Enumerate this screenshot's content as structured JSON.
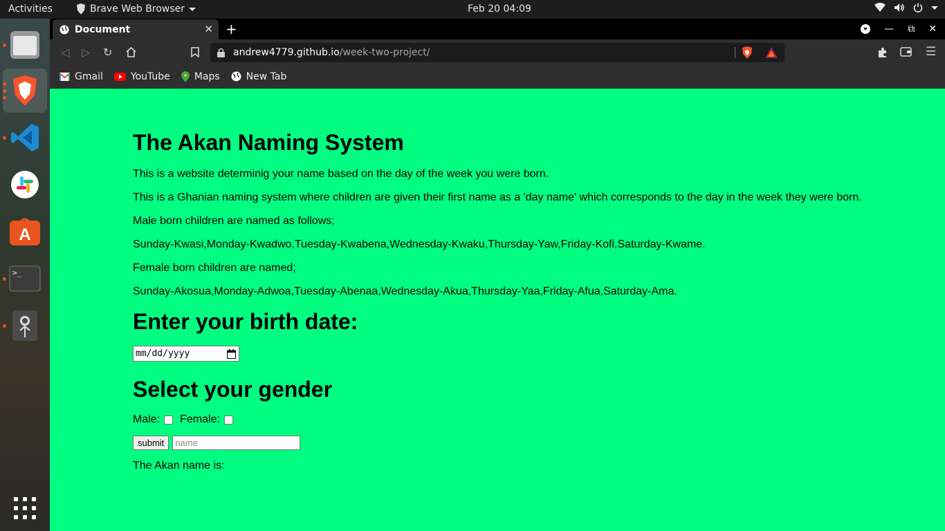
{
  "system": {
    "activities": "Activities",
    "app_menu": "Brave Web Browser",
    "clock": "Feb 20  04:09"
  },
  "dock": {
    "apps": [
      "Files",
      "Brave",
      "Visual Studio Code",
      "Slack",
      "Ubuntu Software",
      "Terminal",
      "Screenshot"
    ]
  },
  "browser": {
    "tab_title": "Document",
    "url_host": "andrew4779.github.io",
    "url_path": "/week-two-project/",
    "bookmarks": [
      "Gmail",
      "YouTube",
      "Maps",
      "New Tab"
    ]
  },
  "page": {
    "title": "The Akan Naming System",
    "paragraphs": [
      "This is a website determinig your name based on the day of the week you were born.",
      "This is a Ghanian naming system where children are given their first name as a 'day name' which corresponds to the day in the week they were born.",
      "Male born children are named as follows;",
      "Sunday-Kwasi,Monday-Kwadwo,Tuesday-Kwabena,Wednesday-Kwaku,Thursday-Yaw,Friday-Kofi,Saturday-Kwame.",
      "Female born children are named;",
      "Sunday-Akosua,Monday-Adwoa,Tuesday-Abenaa,Wednesday-Akua,Thursday-Yaa,Friday-Afua,Saturday-Ama."
    ],
    "birth_heading": "Enter your birth date:",
    "date_placeholder": "mm/dd/yyyy",
    "gender_heading": "Select your gender",
    "male_label": "Male:",
    "female_label": "Female:",
    "submit_label": "submit",
    "name_placeholder": "name",
    "result_label": "The Akan name is:"
  },
  "colors": {
    "page_background": "#00ff80",
    "accent": "#e95420"
  }
}
